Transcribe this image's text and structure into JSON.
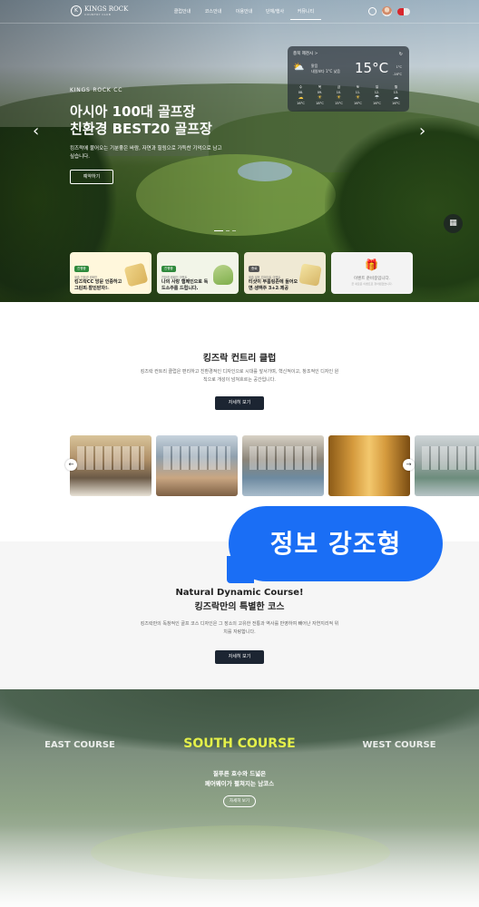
{
  "nav": {
    "logo_text": "KINGS ROCK",
    "logo_sub": "COUNTRY CLUB",
    "menu": [
      "클럽안내",
      "코스안내",
      "이용안내",
      "단체/행사",
      "커뮤니티"
    ],
    "active_index": 4
  },
  "hero": {
    "eyebrow": "KINGS ROCK CC",
    "title_line1": "아시아 100대 골프장",
    "title_line2": "친환경 BEST20 골프장",
    "subtitle": "킹즈락에 불어오는 기분좋은 바람, 자연과 힐링으로 가득찬 기억으로 남고 싶습니다.",
    "reserve_label": "예약하기",
    "prev": "‹",
    "next": "›"
  },
  "weather": {
    "location": "충북 제천시",
    "location_arrow": ">",
    "condition_line1": "맑음",
    "condition_line2": "내일보다 1°C 낮음",
    "temp": "15°C",
    "high": "1°C",
    "low": "-16°C",
    "days": [
      {
        "day": "수",
        "date": "08.",
        "icon": "☁",
        "temp": "16°C",
        "rain": false
      },
      {
        "day": "목",
        "date": "09.",
        "icon": "☀",
        "temp": "18°C",
        "rain": false
      },
      {
        "day": "금",
        "date": "10.",
        "icon": "☀",
        "temp": "15°C",
        "rain": false
      },
      {
        "day": "토",
        "date": "11.",
        "icon": "☀",
        "temp": "16°C",
        "rain": false
      },
      {
        "day": "일",
        "date": "12.",
        "icon": "☂",
        "temp": "16°C",
        "rain": true
      },
      {
        "day": "월",
        "date": "13.",
        "icon": "☁",
        "temp": "16°C",
        "rain": true
      }
    ]
  },
  "promos": [
    {
      "tag": "진행중",
      "small": "제출 친환경 캠페인",
      "title": "킹즈락CC 방문 인증하고 그린피 할인받자!",
      "date": "2023.10.05 ~ 2023.12.31"
    },
    {
      "tag": "진행중",
      "small": "친환경 캠페인 이벤트",
      "title": "나의 사랑 햄페인으로 독도소주를 드립니다.",
      "date": "2023.09.15 ~ 2023.10.15"
    },
    {
      "tag": "종료",
      "small": "제출 발표 업데이트 이벤트",
      "title": "티샷이 부룸링존에 들어오면 생맥주 3+2 제공",
      "date": "2023.08.01 ~ 2023.08.31"
    },
    {
      "tag": "",
      "small": "",
      "title": "이벤트 준비중입니다.",
      "sub": "곧 새로운 이벤트로 찾아뵙겠습니다.",
      "date": ""
    }
  ],
  "club": {
    "title": "킹즈락 컨트리 클럽",
    "desc": "킹즈락 컨트리 클럽은 편리하고 친환경적인 디자인으로 시대를 앞서가며, 혁신적이고, 창조적인 디자인 원칙으로 개성이 넘쳐흐르는 공간입니다.",
    "button": "자세히 보기",
    "prev": "←",
    "next": "→"
  },
  "badge": "정보 강조형",
  "course": {
    "title_line1": "Natural Dynamic Course!",
    "title_line2": "킹즈락만의 특별한 코스",
    "desc": "킹즈락만의 독창적인 골프 코스 디자인은 그 장소의 고유한 전통과 역사를 반영하여 빼어난 자연지리적 위치를 자랑합니다.",
    "button": "자세히 보기"
  },
  "courses": {
    "east": "EAST COURSE",
    "south": "SOUTH COURSE",
    "west": "WEST COURSE",
    "tagline_line1": "짙푸른 호수와 드넓은",
    "tagline_line2": "페어웨이가 펼쳐지는 남코스",
    "button": "자세히 보기"
  }
}
